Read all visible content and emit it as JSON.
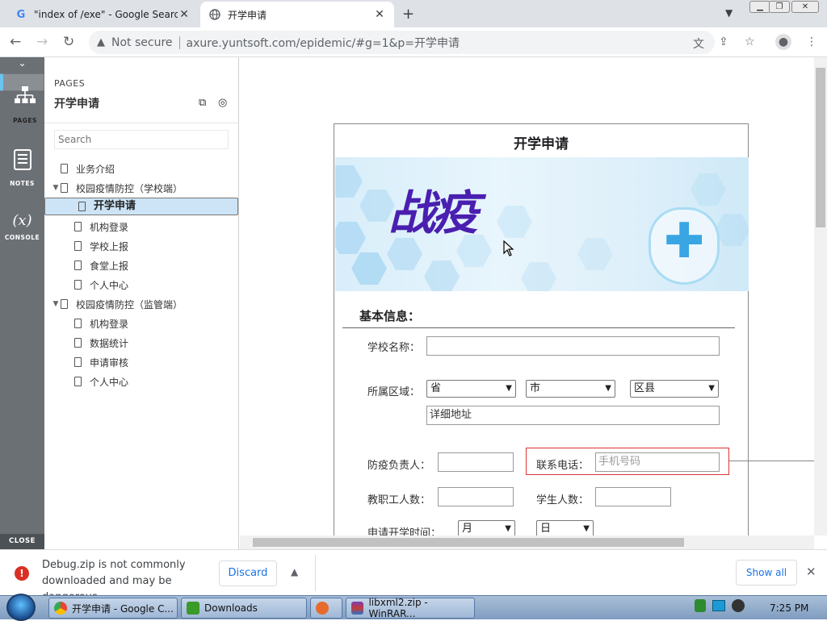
{
  "browser": {
    "tabs": [
      {
        "title": "\"index of /exe\" - Google Search",
        "favicon": "G",
        "active": false
      },
      {
        "title": "开学申请",
        "favicon": "globe",
        "active": true
      }
    ],
    "new_tab": "+",
    "tab_close": "✕",
    "tab_dropdown": "⌄",
    "window_buttons": {
      "minimize": "▁",
      "maximize": "❐",
      "close": "✕"
    },
    "address": {
      "security_label": "Not secure",
      "url": "axure.yuntsoft.com/epidemic/#g=1&p=开学申请"
    }
  },
  "axure_rail": {
    "items": [
      {
        "label": "PAGES",
        "icon": "sitemap-icon"
      },
      {
        "label": "NOTES",
        "icon": "notes-icon"
      },
      {
        "label": "CONSOLE",
        "icon": "variable-icon",
        "glyph": "(x)"
      }
    ],
    "close_label": "CLOSE"
  },
  "pages_panel": {
    "header": "PAGES",
    "current_page": "开学申请",
    "search_placeholder": "Search",
    "tree": [
      {
        "label": "业务介绍",
        "level": 0,
        "folder": false,
        "selected": false
      },
      {
        "label": "校园疫情防控（学校端）",
        "level": 0,
        "folder": true,
        "selected": false
      },
      {
        "label": "开学申请",
        "level": 1,
        "folder": false,
        "selected": true
      },
      {
        "label": "机构登录",
        "level": 1,
        "folder": false,
        "selected": false
      },
      {
        "label": "学校上报",
        "level": 1,
        "folder": false,
        "selected": false
      },
      {
        "label": "食堂上报",
        "level": 1,
        "folder": false,
        "selected": false
      },
      {
        "label": "个人中心",
        "level": 1,
        "folder": false,
        "selected": false
      },
      {
        "label": "校园疫情防控（监管端）",
        "level": 0,
        "folder": true,
        "selected": false
      },
      {
        "label": "机构登录",
        "level": 1,
        "folder": false,
        "selected": false
      },
      {
        "label": "数据统计",
        "level": 1,
        "folder": false,
        "selected": false
      },
      {
        "label": "申请审核",
        "level": 1,
        "folder": false,
        "selected": false
      },
      {
        "label": "个人中心",
        "level": 1,
        "folder": false,
        "selected": false
      }
    ]
  },
  "form": {
    "title": "开学申请",
    "banner_text": "战疫",
    "section_basic": "基本信息：",
    "school_name_label": "学校名称：",
    "school_name_value": "",
    "region_label": "所属区域：",
    "province": "省",
    "city": "市",
    "county": "区县",
    "address_placeholder": "详细地址",
    "person_label": "防疫负责人：",
    "phone_label": "联系电话：",
    "phone_placeholder": "手机号码",
    "staff_label": "教职工人数：",
    "students_label": "学生人数：",
    "start_time_label": "申请开学时间：",
    "month": "月",
    "day": "日"
  },
  "download_bar": {
    "message": "Debug.zip is not commonly downloaded and may be dangerous.",
    "discard_label": "Discard",
    "show_all_label": "Show all"
  },
  "taskbar": {
    "buttons": [
      {
        "label": "开学申请 - Google C..."
      },
      {
        "label": "Downloads"
      },
      {
        "label": ""
      },
      {
        "label": "libxml2.zip - WinRAR..."
      }
    ],
    "clock": "7:25 PM"
  },
  "colors": {
    "accent": "#1a73e8",
    "selected_page_bg": "#cce4f5",
    "rail_bg": "#6b7075",
    "highlight_border": "#dd3333",
    "banner_text": "#4a1fb0"
  }
}
